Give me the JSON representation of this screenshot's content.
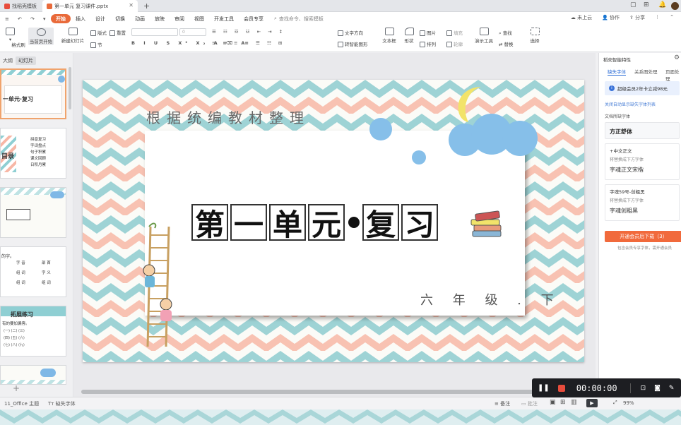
{
  "tabs": {
    "templates": "找稻壳模板",
    "file": "第一单元 复习课件.pptx",
    "new_tab": "+"
  },
  "window": {
    "minimize": "—",
    "restore": "▢",
    "grid": "⊞",
    "close": "✕"
  },
  "menu": {
    "items": [
      "开始",
      "插入",
      "设计",
      "切换",
      "动画",
      "放映",
      "审阅",
      "视图",
      "开发工具",
      "会员专享"
    ],
    "active": "开始",
    "search": "查找命令、搜索模板",
    "cloud": "未上云",
    "collab": "协作",
    "share": "分享"
  },
  "ribbon": {
    "format_painter": "格式刷",
    "current_page": "当前页开始",
    "new_slide": "新建幻灯片",
    "layout": "版式",
    "section": "节",
    "reset": "重置",
    "font_size": "0",
    "text_dir": "文字方向",
    "convert_smart": "转智能图形",
    "textbox": "文本框",
    "shapes": "形状",
    "image": "图片",
    "arrange": "排列",
    "fill": "填充",
    "outline": "轮廓",
    "present_tools": "演示工具",
    "find": "查找",
    "replace": "替换",
    "select": "选择"
  },
  "left_panel": {
    "tab_outline": "大纲",
    "tab_slides": "幻灯片",
    "active_tab": "幻灯片",
    "thumb1_title": "一单元·复习",
    "thumb2_items": [
      "拼音复习",
      "字词盘点",
      "句子积累",
      "课文回顾",
      "日积月累"
    ],
    "thumb2_label": "目录",
    "thumb4_note": "的字。",
    "thumb4_cells": [
      "字 音",
      "部 首",
      "组 词",
      "字 义",
      "组 词",
      "组 词"
    ],
    "thumb5_title": "拓展练习",
    "thumb5_sub": "有的要加偏旁。",
    "add": "+"
  },
  "slide": {
    "subtitle": "根据统编教材整理",
    "title_chars": [
      "第",
      "一",
      "单",
      "元",
      "复",
      "习"
    ],
    "grade": "六 年 级 . 下"
  },
  "right_panel": {
    "header": "稻壳智能特性",
    "tabs": [
      "缺失字体",
      "关系图处理",
      "页面处理"
    ],
    "active_tab": "缺失字体",
    "promo": "超级会员2年卡立减98元",
    "missing_link": "关闭自动显示缺失字体列表",
    "doc_fonts_label": "文档所缺字体",
    "fonts": [
      {
        "name": "方正舒体",
        "hint": "",
        "preview": "方正舒体",
        "highlight": true
      },
      {
        "name": "+中文正文",
        "hint": "将替换成下方字体",
        "preview": "字魂正文宋楷"
      },
      {
        "name": "字魂59号-创粗黑",
        "hint": "将替换成下方字体",
        "preview": "字魂创粗黑"
      }
    ],
    "download_btn": "开通会员后下载（3）",
    "download_note": "包含会员专享字体，需开通会员"
  },
  "status": {
    "theme": "11_Office 主题",
    "missing_fonts": "缺失字体",
    "notes": "备注",
    "comment": "批注",
    "zoom": "99%"
  },
  "recorder": {
    "time": "00:00:00"
  },
  "colors": {
    "accent": "#e96a3a",
    "teal": "#8fcfd3",
    "pink": "#f7b7a6",
    "blue": "#7fb8e6"
  }
}
